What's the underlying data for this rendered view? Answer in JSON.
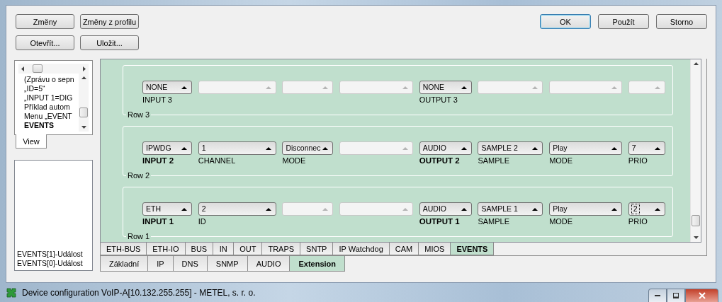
{
  "change_buttons": [
    {
      "label": "Změny"
    },
    {
      "label": "Změny z profilu"
    }
  ],
  "dialog_buttons": [
    {
      "label": "OK",
      "default": true
    },
    {
      "label": "Použít",
      "default": false
    },
    {
      "label": "Storno",
      "default": false
    }
  ],
  "file_buttons": [
    {
      "label": "Otevřít..."
    },
    {
      "label": "Uložit..."
    }
  ],
  "tree": [
    {
      "label": "(Zprávu o sepn",
      "kind": "item"
    },
    {
      "label": "„ID=5“",
      "kind": "item"
    },
    {
      "label": "„INPUT 1=DIG",
      "kind": "item"
    },
    {
      "label": "Příklad autom",
      "kind": "item"
    },
    {
      "label": "Menu „EVENT",
      "kind": "item"
    },
    {
      "label": "EVENTS",
      "kind": "group"
    }
  ],
  "view_tab": {
    "label": "View"
  },
  "event_list": {
    "items": [
      "EVENTS[1]-Událost",
      "EVENTS[0]-Událost"
    ]
  },
  "rows": [
    {
      "legend": "Row 3",
      "fields": [
        {
          "label": "INPUT 3",
          "label_bold": false,
          "value": "NONE",
          "disabled": false,
          "focused": false
        },
        {
          "disabled": true,
          "focused": false
        },
        {
          "disabled": true,
          "focused": false
        },
        {
          "disabled": true,
          "focused": false
        },
        {
          "label": "OUTPUT 3",
          "label_bold": false,
          "value": "NONE",
          "disabled": false,
          "focused": false
        },
        {
          "disabled": true,
          "focused": false
        },
        {
          "disabled": true,
          "focused": false
        },
        {
          "disabled": true,
          "focused": false
        }
      ]
    },
    {
      "legend": "Row 2",
      "fields": [
        {
          "label": "INPUT 2",
          "label_bold": true,
          "value": "IPWDG",
          "disabled": false,
          "focused": false
        },
        {
          "label": "CHANNEL",
          "label_bold": false,
          "value": "1",
          "disabled": false,
          "focused": false
        },
        {
          "label": "MODE",
          "label_bold": false,
          "value": "Disconnec",
          "disabled": false,
          "focused": false
        },
        {
          "disabled": true,
          "focused": false
        },
        {
          "label": "OUTPUT 2",
          "label_bold": true,
          "value": "AUDIO",
          "disabled": false,
          "focused": false
        },
        {
          "label": "SAMPLE",
          "label_bold": false,
          "value": "SAMPLE 2",
          "disabled": false,
          "focused": false
        },
        {
          "label": "MODE",
          "label_bold": false,
          "value": "Play",
          "disabled": false,
          "focused": false
        },
        {
          "label": "PRIO",
          "label_bold": false,
          "value": "7",
          "disabled": false,
          "focused": false
        }
      ]
    },
    {
      "legend": "Row 1",
      "fields": [
        {
          "label": "INPUT 1",
          "label_bold": true,
          "value": "ETH",
          "disabled": false,
          "focused": false
        },
        {
          "label": "ID",
          "label_bold": false,
          "value": "2",
          "disabled": false,
          "focused": false
        },
        {
          "disabled": true,
          "focused": false
        },
        {
          "disabled": true,
          "focused": false
        },
        {
          "label": "OUTPUT 1",
          "label_bold": true,
          "value": "AUDIO",
          "disabled": false,
          "focused": false
        },
        {
          "label": "SAMPLE",
          "label_bold": false,
          "value": "SAMPLE 1",
          "disabled": false,
          "focused": false
        },
        {
          "label": "MODE",
          "label_bold": false,
          "value": "Play",
          "disabled": false,
          "focused": false
        },
        {
          "label": "PRIO",
          "label_bold": false,
          "value": "2",
          "disabled": false,
          "focused": true
        }
      ]
    }
  ],
  "sub_tabs": [
    {
      "label": "ETH-BUS",
      "selected": false
    },
    {
      "label": "ETH-IO",
      "selected": false
    },
    {
      "label": "BUS",
      "selected": false
    },
    {
      "label": "IN",
      "selected": false
    },
    {
      "label": "OUT",
      "selected": false
    },
    {
      "label": "TRAPS",
      "selected": false
    },
    {
      "label": "SNTP",
      "selected": false
    },
    {
      "label": "IP Watchdog",
      "selected": false
    },
    {
      "label": "CAM",
      "selected": false
    },
    {
      "label": "MIOS",
      "selected": false
    },
    {
      "label": "EVENTS",
      "selected": true
    }
  ],
  "main_tabs": [
    {
      "label": "Základní",
      "selected": false
    },
    {
      "label": "IP",
      "selected": false
    },
    {
      "label": "DNS",
      "selected": false
    },
    {
      "label": "SNMP",
      "selected": false
    },
    {
      "label": "AUDIO",
      "selected": false
    },
    {
      "label": "Extension",
      "selected": true
    }
  ],
  "window": {
    "title": "Device configuration VoIP-A[10.132.255.255] - METEL, s. r. o."
  }
}
